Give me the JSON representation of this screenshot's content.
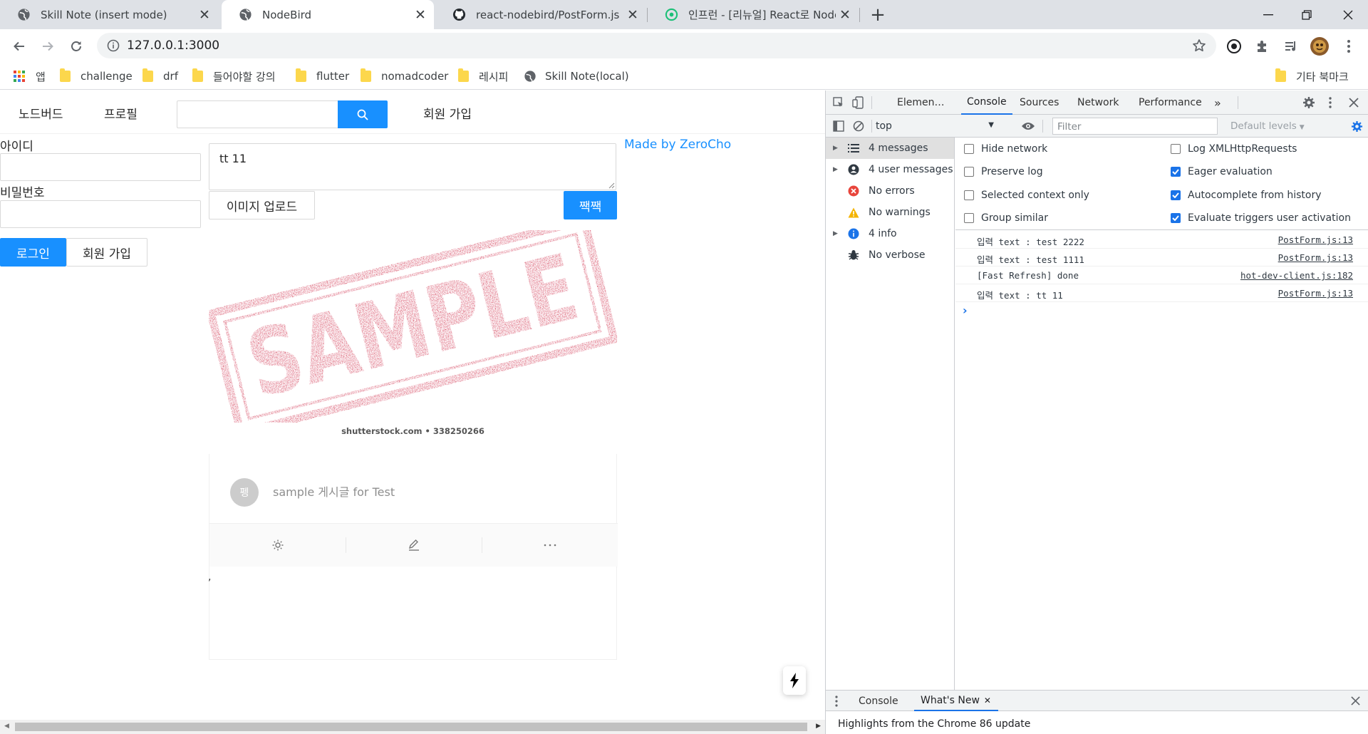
{
  "browser": {
    "tabs": [
      {
        "title": "Skill Note (insert mode)",
        "icon": "globe-icon"
      },
      {
        "title": "NodeBird",
        "icon": "globe-icon"
      },
      {
        "title": "react-nodebird/PostForm.js at m",
        "icon": "github-icon"
      },
      {
        "title": "인프런 - [리뉴얼] React로 NodeB",
        "icon": "inflearn-icon"
      }
    ],
    "url": "127.0.0.1:3000",
    "bookmarks": [
      {
        "label": "앱",
        "icon": "apps-grid-icon"
      },
      {
        "label": "challenge",
        "icon": "folder-icon"
      },
      {
        "label": "drf",
        "icon": "folder-icon"
      },
      {
        "label": "들어야할 강의",
        "icon": "folder-icon"
      },
      {
        "label": "flutter",
        "icon": "folder-icon"
      },
      {
        "label": "nomadcoder",
        "icon": "folder-icon"
      },
      {
        "label": "레시피",
        "icon": "folder-icon"
      },
      {
        "label": "Skill Note(local)",
        "icon": "globe-icon"
      }
    ],
    "other_bookmarks": "기타 북마크"
  },
  "app": {
    "menu": {
      "home": "노드버드",
      "profile": "프로필",
      "signup": "회원 가입"
    },
    "search": {
      "value": "",
      "icon": "search-icon"
    },
    "login_form": {
      "id_label": "아이디",
      "password_label": "비밀번호",
      "login_button": "로그인",
      "signup_button": "회원 가입"
    },
    "post_form": {
      "text": "tt 11",
      "upload_button": "이미지 업로드",
      "submit_button": "짹짹"
    },
    "credit_link": "Made by ZeroCho",
    "post": {
      "image_word": "SAMPLE",
      "image_caption": "shutterstock.com • 338250266",
      "avatar_initial": "펭",
      "content": "sample 게시글 for Test",
      "actions": [
        "settings-icon",
        "edit-icon",
        "ellipsis-icon"
      ]
    },
    "stray_text": ","
  },
  "devtools": {
    "tabs": [
      "Elemen…",
      "Console",
      "Sources",
      "Network",
      "Performance"
    ],
    "active_tab": "Console",
    "context": "top",
    "filter_placeholder": "Filter",
    "levels": "Default levels",
    "sidebar": [
      {
        "label": "4 messages",
        "icon": "list-icon",
        "expandable": true
      },
      {
        "label": "4 user messages",
        "icon": "user-icon",
        "expandable": true
      },
      {
        "label": "No errors",
        "icon": "error-icon",
        "expandable": false
      },
      {
        "label": "No warnings",
        "icon": "warning-icon",
        "expandable": false
      },
      {
        "label": "4 info",
        "icon": "info-icon",
        "expandable": true
      },
      {
        "label": "No verbose",
        "icon": "bug-icon",
        "expandable": false
      }
    ],
    "settings": {
      "left": [
        {
          "label": "Hide network",
          "checked": false
        },
        {
          "label": "Preserve log",
          "checked": false
        },
        {
          "label": "Selected context only",
          "checked": false
        },
        {
          "label": "Group similar",
          "checked": false
        }
      ],
      "right": [
        {
          "label": "Log XMLHttpRequests",
          "checked": false
        },
        {
          "label": "Eager evaluation",
          "checked": true
        },
        {
          "label": "Autocomplete from history",
          "checked": true
        },
        {
          "label": "Evaluate triggers user activation",
          "checked": true
        }
      ]
    },
    "logs": [
      {
        "message": "입력 text : test 2222",
        "source": "PostForm.js:13"
      },
      {
        "message": "입력 text : test 1111",
        "source": "PostForm.js:13"
      },
      {
        "message": "[Fast Refresh] done",
        "source": "hot-dev-client.js:182"
      },
      {
        "message": "입력 text : tt 11",
        "source": "PostForm.js:13"
      }
    ],
    "prompt": "›",
    "drawer": {
      "tabs": [
        "Console",
        "What's New"
      ],
      "active": "What's New",
      "highlight": "Highlights from the Chrome 86 update"
    }
  },
  "colors": {
    "primary": "#1890ff",
    "sample_red": "#c8102e",
    "devtools_accent": "#1a73e8"
  }
}
